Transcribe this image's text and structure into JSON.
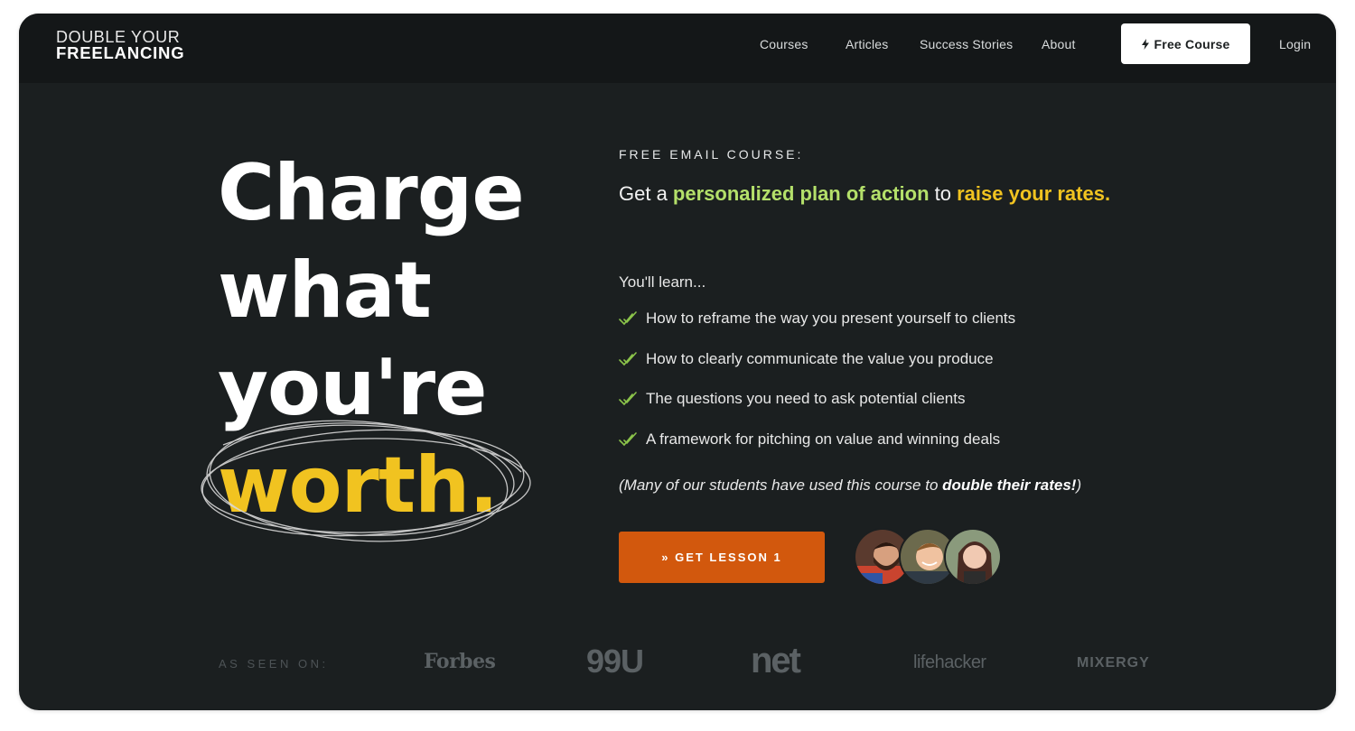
{
  "header": {
    "logo_top": "DOUBLE YOUR",
    "logo_bottom": "FREELANCING",
    "nav": [
      "Courses",
      "Articles",
      "Success Stories",
      "About"
    ],
    "cta_label": "Free Course",
    "login_label": "Login"
  },
  "hero": {
    "headline": [
      "Charge",
      "what",
      "you're",
      "worth."
    ],
    "eyebrow": "FREE EMAIL COURSE:",
    "subhead": {
      "prefix": "Get a ",
      "highlight_green": "personalized plan of action",
      "middle": " to ",
      "highlight_yellow": "raise your rates."
    },
    "learn_label": "You'll learn...",
    "bullets": [
      "How to reframe the way you present yourself to clients",
      "How to clearly communicate the value you produce",
      "The questions you need to ask potential clients",
      "A framework for pitching on value and winning deals"
    ],
    "note": {
      "prefix": "(Many of our students have used this course to ",
      "bold": "double their rates!",
      "suffix": ")"
    },
    "cta_label": "» GET LESSON 1",
    "avatars": [
      "avatar-bearded-man",
      "avatar-smiling-man",
      "avatar-woman"
    ]
  },
  "press": {
    "label": "AS SEEN ON:",
    "logos": [
      "Forbes",
      "99U",
      "net",
      "lifehacker",
      "MIXERGY"
    ]
  },
  "colors": {
    "background": "#1b1f20",
    "header": "#141718",
    "accent_yellow": "#f1c320",
    "accent_green": "#b4e06a",
    "cta_orange": "#d2580d"
  }
}
